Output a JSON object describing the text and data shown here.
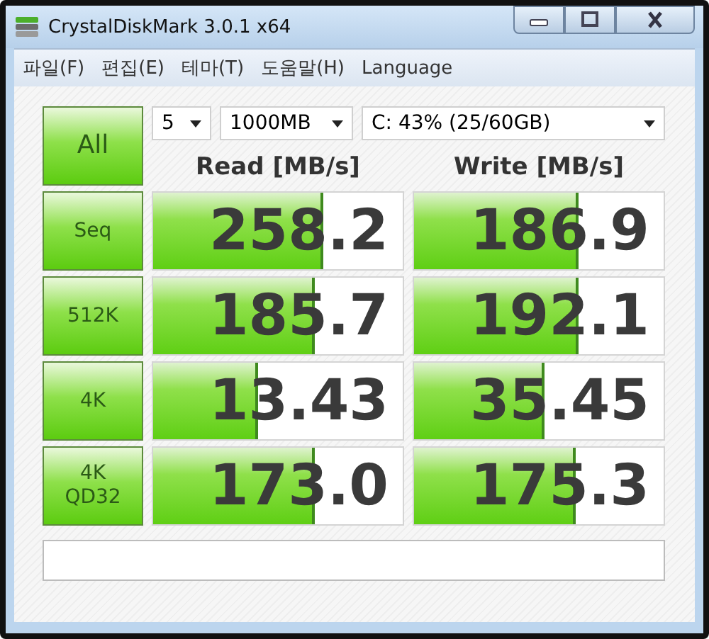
{
  "window": {
    "title": "CrystalDiskMark 3.0.1 x64"
  },
  "menu": [
    "파일(F)",
    "편집(E)",
    "테마(T)",
    "도움말(H)",
    "Language"
  ],
  "all_button": "All",
  "selectors": [
    {
      "value": "5"
    },
    {
      "value": "1000MB"
    },
    {
      "value": "C: 43% (25/60GB)"
    }
  ],
  "headers": [
    "Read [MB/s]",
    "Write [MB/s]"
  ],
  "tests": [
    {
      "label": "Seq",
      "read": {
        "value": "258.2",
        "level": 0.68
      },
      "write": {
        "value": "186.9",
        "level": 0.66
      }
    },
    {
      "label": "512K",
      "read": {
        "value": "185.7",
        "level": 0.65
      },
      "write": {
        "value": "192.1",
        "level": 0.66
      }
    },
    {
      "label": "4K",
      "read": {
        "value": "13.43",
        "level": 0.42
      },
      "write": {
        "value": "35.45",
        "level": 0.52
      }
    },
    {
      "label": "4K\nQD32",
      "read": {
        "value": "173.0",
        "level": 0.65
      },
      "write": {
        "value": "175.3",
        "level": 0.65
      }
    }
  ]
}
